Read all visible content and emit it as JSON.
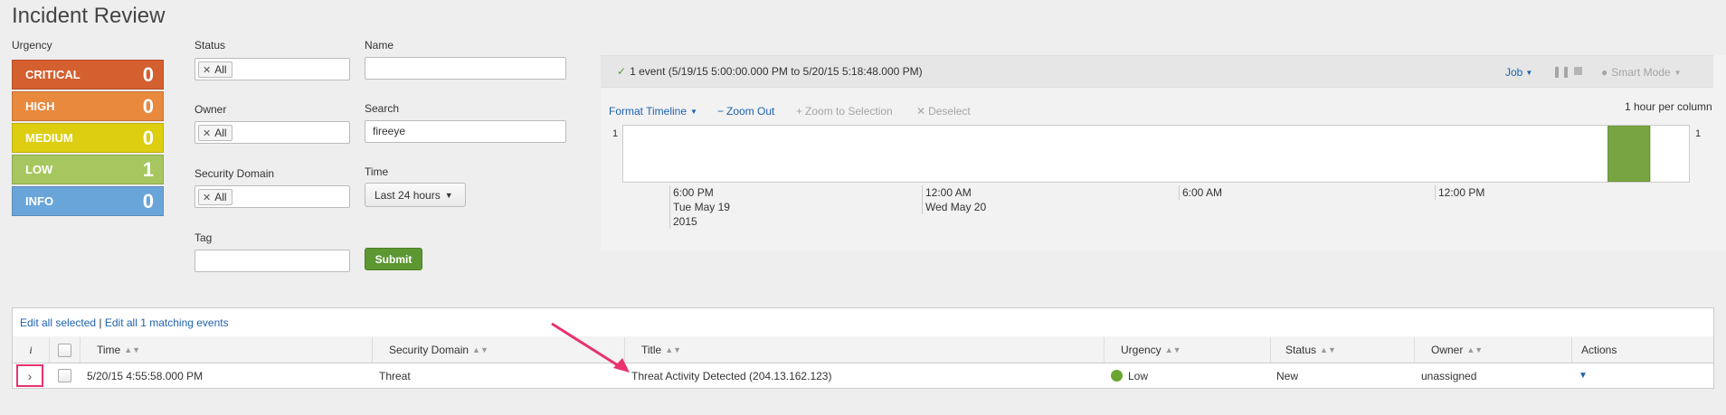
{
  "page": {
    "title": "Incident Review"
  },
  "urgency": {
    "label": "Urgency",
    "items": [
      {
        "label": "CRITICAL",
        "count": "0",
        "color": "#d45f2f"
      },
      {
        "label": "HIGH",
        "count": "0",
        "color": "#e8893e"
      },
      {
        "label": "MEDIUM",
        "count": "0",
        "color": "#ddce12"
      },
      {
        "label": "LOW",
        "count": "1",
        "color": "#a6c65f"
      },
      {
        "label": "INFO",
        "count": "0",
        "color": "#6aa5da"
      }
    ]
  },
  "filters": {
    "status_label": "Status",
    "status_token": "All",
    "name_label": "Name",
    "name_value": "",
    "owner_label": "Owner",
    "owner_token": "All",
    "search_label": "Search",
    "search_value": "fireeye",
    "security_domain_label": "Security Domain",
    "security_domain_token": "All",
    "time_label": "Time",
    "time_value": "Last 24 hours",
    "tag_label": "Tag",
    "tag_value": "",
    "submit_label": "Submit"
  },
  "timeline": {
    "event_summary": "1 event (5/19/15 5:00:00.000 PM to 5/20/15 5:18:48.000 PM)",
    "job_label": "Job",
    "mode_label": "Smart Mode",
    "format_timeline": "Format Timeline",
    "zoom_out": "Zoom Out",
    "zoom_selection": "Zoom to Selection",
    "deselect": "Deselect",
    "bucket_label": "1 hour per column",
    "y_left": "1",
    "y_right": "1",
    "ticks": [
      {
        "line1": "6:00 PM",
        "line2": "Tue May 19",
        "line3": "2015"
      },
      {
        "line1": "12:00 AM",
        "line2": "Wed May 20",
        "line3": ""
      },
      {
        "line1": "6:00 AM",
        "line2": "",
        "line3": ""
      },
      {
        "line1": "12:00 PM",
        "line2": "",
        "line3": ""
      }
    ],
    "accent": "#78a542"
  },
  "chart_data": {
    "type": "bar",
    "x": [
      "5/20/15 4:00 PM"
    ],
    "values": [
      1
    ],
    "ylim": [
      0,
      1
    ]
  },
  "table": {
    "edit_selected": "Edit all selected",
    "separator": "|",
    "edit_matching": "Edit all 1 matching events",
    "headers": {
      "info": "i",
      "time": "Time",
      "security_domain": "Security Domain",
      "title": "Title",
      "urgency": "Urgency",
      "status": "Status",
      "owner": "Owner",
      "actions": "Actions"
    },
    "rows": [
      {
        "time": "5/20/15 4:55:58.000 PM",
        "security_domain": "Threat",
        "title": "Threat Activity Detected (204.13.162.123)",
        "urgency": "Low",
        "urgency_color": "#6aa62f",
        "status": "New",
        "owner": "unassigned"
      }
    ]
  },
  "annotation": {
    "arrow_color": "#e8336d",
    "highlight_color": "#e8336d"
  }
}
